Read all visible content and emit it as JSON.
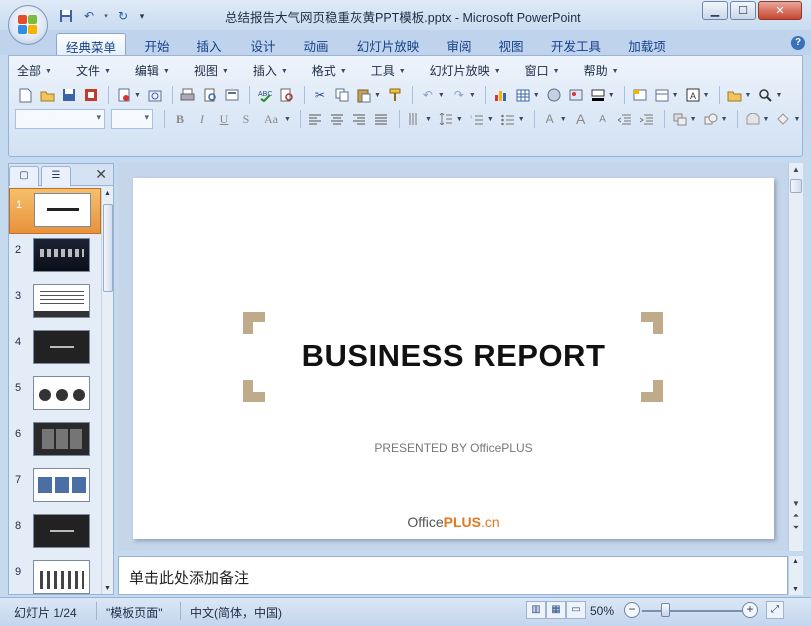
{
  "window": {
    "title": "总结报告大气网页稳重灰黄PPT模板.pptx - Microsoft PowerPoint",
    "minimize_label": "▁",
    "maximize_label": "☐",
    "close_label": "✕"
  },
  "qat": {
    "icons": [
      "save-icon",
      "undo-icon",
      "redo-icon",
      "customize-icon"
    ]
  },
  "ribbon_tabs": [
    {
      "label": "经典菜单",
      "active": true
    },
    {
      "label": "开始",
      "active": false
    },
    {
      "label": "插入",
      "active": false
    },
    {
      "label": "设计",
      "active": false
    },
    {
      "label": "动画",
      "active": false
    },
    {
      "label": "幻灯片放映",
      "active": false
    },
    {
      "label": "审阅",
      "active": false
    },
    {
      "label": "视图",
      "active": false
    },
    {
      "label": "开发工具",
      "active": false
    },
    {
      "label": "加载项",
      "active": false
    }
  ],
  "help_label": "?",
  "menubar": [
    {
      "label": "全部"
    },
    {
      "label": "文件"
    },
    {
      "label": "编辑"
    },
    {
      "label": "视图"
    },
    {
      "label": "插入"
    },
    {
      "label": "格式"
    },
    {
      "label": "工具"
    },
    {
      "label": "幻灯片放映"
    },
    {
      "label": "窗口"
    },
    {
      "label": "帮助"
    }
  ],
  "slides_panel": {
    "tab_slides": "▢",
    "tab_outline": "☰",
    "close": "✕",
    "slides": [
      {
        "num": "1",
        "style": "light"
      },
      {
        "num": "2",
        "style": "dark-city"
      },
      {
        "num": "3",
        "style": "light-list"
      },
      {
        "num": "4",
        "style": "dark"
      },
      {
        "num": "5",
        "style": "light-people"
      },
      {
        "num": "6",
        "style": "dark-grid"
      },
      {
        "num": "7",
        "style": "light-photos"
      },
      {
        "num": "8",
        "style": "dark"
      },
      {
        "num": "9",
        "style": "light-chart"
      }
    ]
  },
  "slide": {
    "title": "BUSINESS REPORT",
    "subtitle": "PRESENTED BY OfficePLUS",
    "logo_office": "Office",
    "logo_plus": "PLUS",
    "logo_cn": ".cn",
    "accent_color": "#bfaa8a"
  },
  "notes": {
    "placeholder": "单击此处添加备注"
  },
  "statusbar": {
    "slide_info": "幻灯片 1/24",
    "theme": "\"模板页面\"",
    "language": "中文(简体，中国)",
    "zoom": "50%",
    "zoom_level": 0.5
  },
  "colors": {
    "ribbon_bg": "#dce8f6",
    "selected_thumb": "#e8923a",
    "close_btn": "#c8472f"
  }
}
